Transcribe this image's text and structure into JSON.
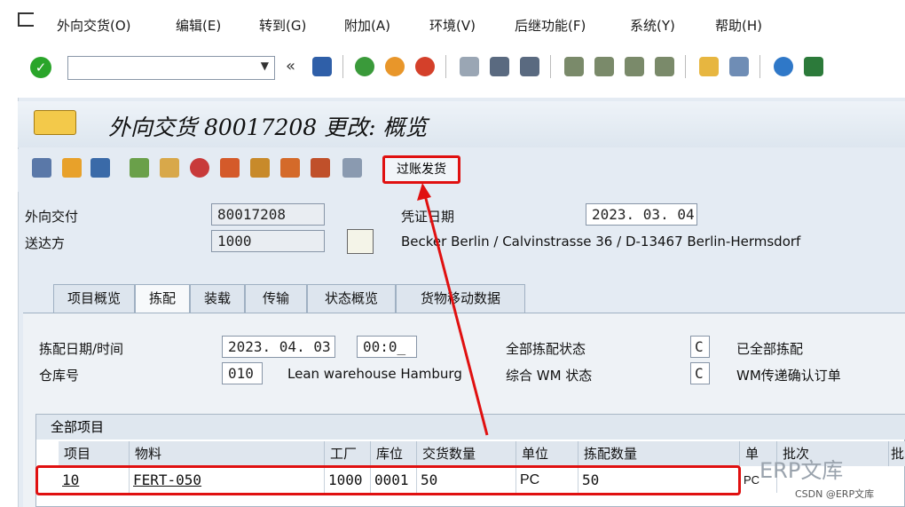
{
  "menu": [
    "外向交货(O)",
    "编辑(E)",
    "转到(G)",
    "附加(A)",
    "环境(V)",
    "后继功能(F)",
    "系统(Y)",
    "帮助(H)"
  ],
  "title": "外向交货 80017208 更改: 概览",
  "app_toolbar": {
    "post_goods_issue": "过账发货"
  },
  "header": {
    "outbound_delivery_label": "外向交付",
    "outbound_delivery_value": "80017208",
    "ship_to_label": "送达方",
    "ship_to_value": "1000",
    "doc_date_label": "凭证日期",
    "doc_date_value": "2023. 03. 04",
    "ship_to_address": "Becker Berlin / Calvinstrasse 36 / D-13467 Berlin-Hermsdorf"
  },
  "tabs": [
    "项目概览",
    "拣配",
    "装载",
    "传输",
    "状态概览",
    "货物移动数据"
  ],
  "picking": {
    "pick_date_label": "拣配日期/时间",
    "pick_date": "2023. 04. 03",
    "pick_time": "00:0_",
    "warehouse_label": "仓库号",
    "warehouse_no": "010",
    "warehouse_name": "Lean warehouse Hamburg",
    "overall_pick_status_label": "全部拣配状态",
    "overall_pick_status": "C",
    "overall_pick_status_text": "已全部拣配",
    "wm_status_label": "综合 WM 状态",
    "wm_status": "C",
    "wm_status_text": "WM传递确认订单"
  },
  "items_table": {
    "title": "全部项目",
    "columns": [
      "项目",
      "物料",
      "工厂",
      "库位",
      "交货数量",
      "单位",
      "拣配数量",
      "单",
      "批次",
      "批"
    ],
    "rows": [
      {
        "item": "10",
        "material": "FERT-050",
        "plant": "1000",
        "sloc": "0001",
        "qty": "50",
        "unit": "PC",
        "picked": "50",
        "unit2": "PC"
      }
    ]
  },
  "watermark": {
    "logo": "ERP文库",
    "credit": "CSDN @ERP文库"
  }
}
